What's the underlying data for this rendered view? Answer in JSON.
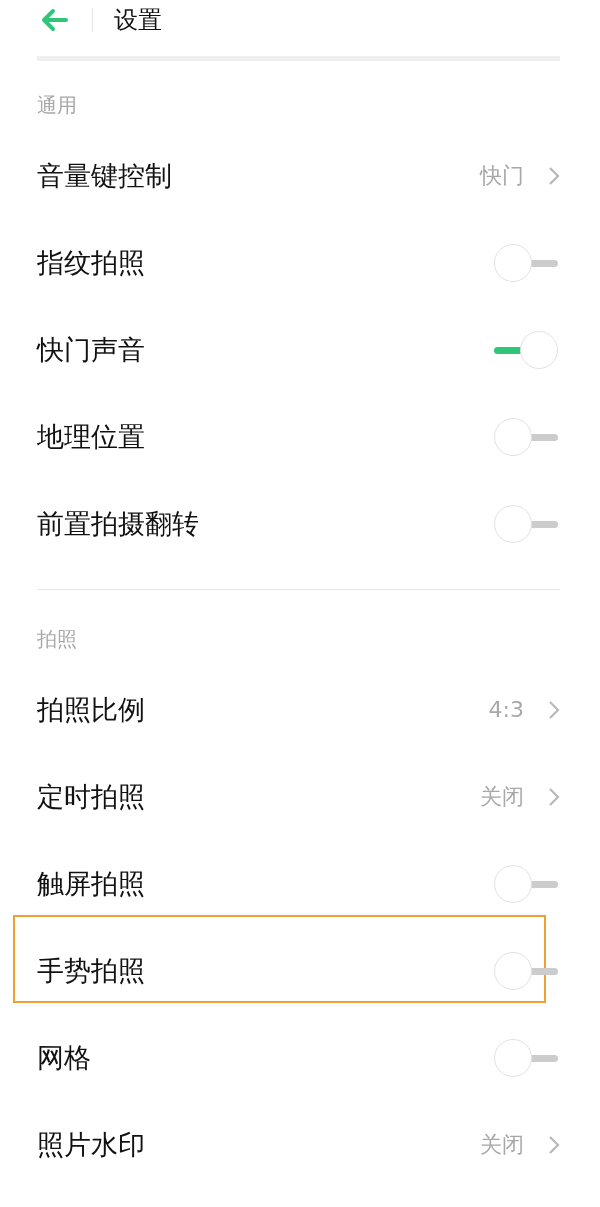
{
  "header": {
    "back_icon": true,
    "title": "设置"
  },
  "sections": [
    {
      "title": "通用",
      "items": [
        {
          "kind": "link",
          "label": "音量键控制",
          "value": "快门"
        },
        {
          "kind": "switch",
          "label": "指纹拍照",
          "on": false
        },
        {
          "kind": "switch",
          "label": "快门声音",
          "on": true
        },
        {
          "kind": "switch",
          "label": "地理位置",
          "on": false
        },
        {
          "kind": "switch",
          "label": "前置拍摄翻转",
          "on": false
        }
      ]
    },
    {
      "title": "拍照",
      "items": [
        {
          "kind": "link",
          "label": "拍照比例",
          "value": "4:3"
        },
        {
          "kind": "link",
          "label": "定时拍照",
          "value": "关闭"
        },
        {
          "kind": "switch",
          "label": "触屏拍照",
          "on": false
        },
        {
          "kind": "switch",
          "label": "手势拍照",
          "on": false,
          "highlighted": true
        },
        {
          "kind": "switch",
          "label": "网格",
          "on": false
        },
        {
          "kind": "link",
          "label": "照片水印",
          "value": "关闭"
        }
      ]
    }
  ]
}
